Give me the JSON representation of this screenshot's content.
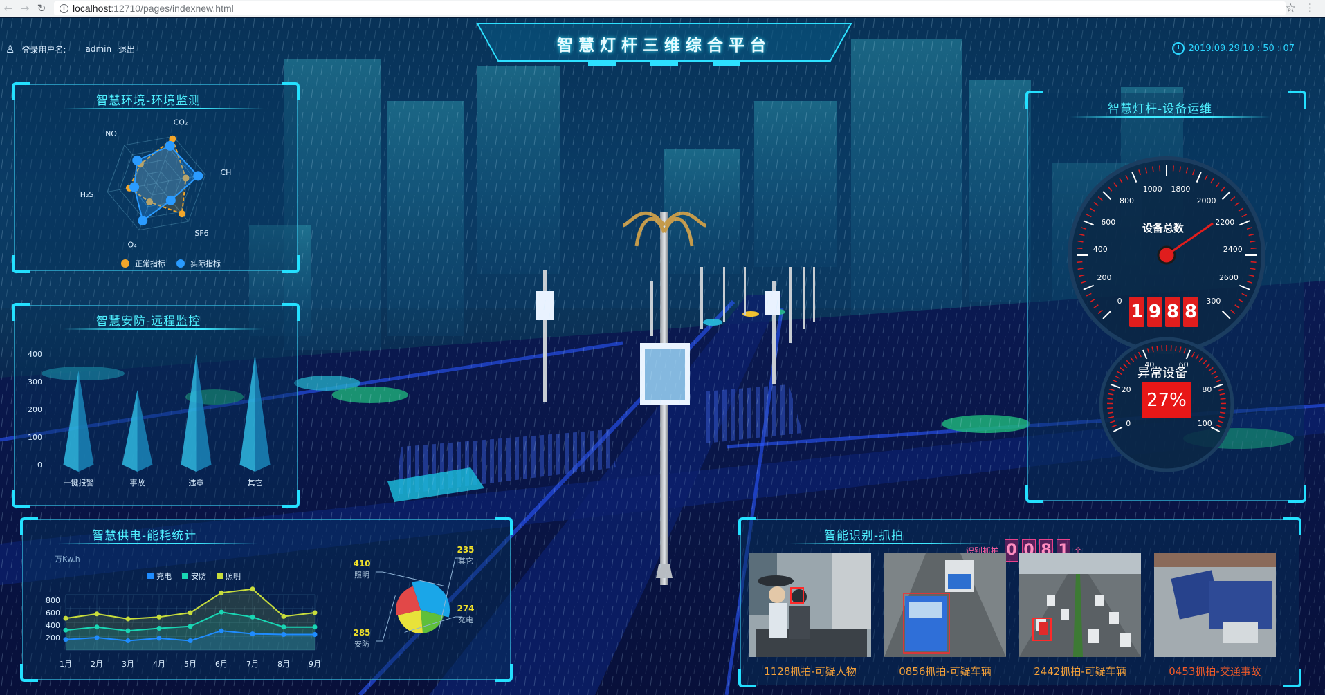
{
  "browser": {
    "url_host": "localhost",
    "url_path": ":12710/pages/indexnew.html"
  },
  "header": {
    "title": "智慧灯杆三维综合平台",
    "user_label": "登录用户名:",
    "username": "admin",
    "logout": "退出",
    "datetime": "2019.09.29 10 : 50 : 07"
  },
  "env_panel": {
    "title": "智慧环境-环境监测",
    "axes": [
      "CO₂",
      "CH",
      "SF6",
      "O₄",
      "H₂S",
      "NO"
    ],
    "legend": [
      {
        "label": "正常指标",
        "color": "#f3a62a"
      },
      {
        "label": "实际指标",
        "color": "#2a9bff"
      }
    ]
  },
  "security_panel": {
    "title": "智慧安防-远程监控"
  },
  "energy_panel": {
    "title": "智慧供电-能耗统计",
    "unit": "万Kw.h"
  },
  "device_panel": {
    "title": "智慧灯杆-设备运维",
    "gauge_label": "设备总数",
    "gauge_ticks": [
      "0",
      "200",
      "400",
      "600",
      "800",
      "1000",
      "1800",
      "2000",
      "2200",
      "2400",
      "2600",
      "300"
    ],
    "total_digits": [
      "1",
      "9",
      "8",
      "8"
    ],
    "abnormal_label": "异常设备",
    "abnormal_pct": "27%",
    "small_ticks": [
      "0",
      "20",
      "40",
      "60",
      "80",
      "100"
    ]
  },
  "capture_panel": {
    "title": "智能识别-抓拍",
    "count_label": "识别抓拍",
    "count_digits": [
      "0",
      "0",
      "8",
      "1"
    ],
    "count_unit": "个",
    "photos": [
      {
        "caption": "1128抓拍-可疑人物",
        "color": "#f4a13a"
      },
      {
        "caption": "0856抓拍-可疑车辆",
        "color": "#f4a13a"
      },
      {
        "caption": "2442抓拍-可疑车辆",
        "color": "#f4a13a"
      },
      {
        "caption": "0453抓拍-交通事故",
        "color": "#f05a28"
      }
    ]
  },
  "chart_data": [
    {
      "type": "radar",
      "indicators": [
        "CO₂",
        "CH",
        "SF6",
        "O₄",
        "H₂S",
        "NO"
      ],
      "series": [
        {
          "name": "正常指标",
          "values": [
            95,
            60,
            80,
            40,
            55,
            50
          ]
        },
        {
          "name": "实际指标",
          "values": [
            80,
            85,
            45,
            80,
            45,
            60
          ]
        }
      ]
    },
    {
      "type": "bar",
      "categories": [
        "一键报警",
        "事故",
        "违章",
        "其它"
      ],
      "values": [
        340,
        270,
        400,
        400
      ],
      "ylim": [
        0,
        400
      ],
      "yticks": [
        0,
        100,
        200,
        300,
        400
      ]
    },
    {
      "type": "line",
      "categories": [
        "1月",
        "2月",
        "3月",
        "4月",
        "5月",
        "6月",
        "7月",
        "8月",
        "9月"
      ],
      "series": [
        {
          "name": "充电",
          "color": "#1f8cff",
          "values": [
            170,
            200,
            150,
            190,
            150,
            310,
            260,
            250,
            250
          ]
        },
        {
          "name": "安防",
          "color": "#19d6b4",
          "values": [
            320,
            370,
            310,
            350,
            380,
            610,
            530,
            370,
            370
          ]
        },
        {
          "name": "照明",
          "color": "#c8dd3c",
          "values": [
            510,
            580,
            500,
            530,
            600,
            920,
            980,
            540,
            600
          ]
        }
      ],
      "ylim": [
        0,
        1000
      ],
      "yticks": [
        200,
        400,
        600,
        800
      ]
    },
    {
      "type": "pie",
      "labels": [
        "照明",
        "其它",
        "充电",
        "安防"
      ],
      "values": [
        410,
        235,
        274,
        285
      ],
      "colors": [
        "#1aa6e8",
        "#5fbf3a",
        "#e8e23a",
        "#e24848"
      ]
    }
  ]
}
